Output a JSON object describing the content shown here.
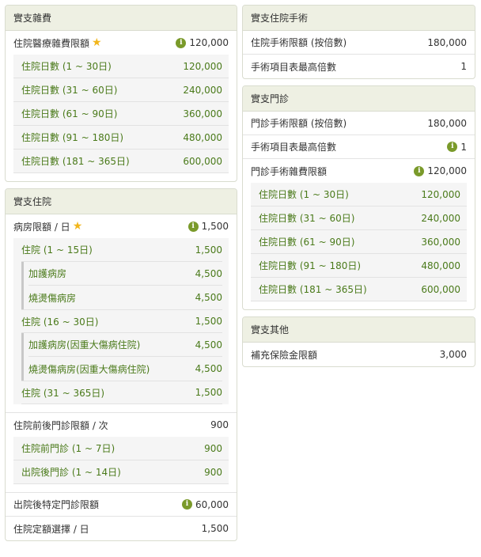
{
  "misc": {
    "header": "實支雜費",
    "limit_label": "住院醫療雜費限額",
    "limit_value": "120,000",
    "items": [
      {
        "label": "住院日數 (1 ~ 30日)",
        "value": "120,000"
      },
      {
        "label": "住院日數 (31 ~ 60日)",
        "value": "240,000"
      },
      {
        "label": "住院日數 (61 ~ 90日)",
        "value": "360,000"
      },
      {
        "label": "住院日數 (91 ~ 180日)",
        "value": "480,000"
      },
      {
        "label": "住院日數 (181 ~ 365日)",
        "value": "600,000"
      }
    ]
  },
  "hosp": {
    "header": "實支住院",
    "room_label": "病房限額 / 日",
    "room_value": "1,500",
    "tiers": [
      {
        "label": "住院 (1 ~ 15日)",
        "value": "1,500",
        "subs": [
          {
            "label": "加護病房",
            "value": "4,500"
          },
          {
            "label": "燒燙傷病房",
            "value": "4,500"
          }
        ]
      },
      {
        "label": "住院 (16 ~ 30日)",
        "value": "1,500",
        "subs": [
          {
            "label": "加護病房(因重大傷病住院)",
            "value": "4,500"
          },
          {
            "label": "燒燙傷病房(因重大傷病住院)",
            "value": "4,500"
          }
        ]
      },
      {
        "label": "住院 (31 ~ 365日)",
        "value": "1,500"
      }
    ],
    "outpatient_label": "住院前後門診限額 / 次",
    "outpatient_value": "900",
    "outpatient_items": [
      {
        "label": "住院前門診 (1 ~ 7日)",
        "value": "900"
      },
      {
        "label": "出院後門診 (1 ~ 14日)",
        "value": "900"
      }
    ],
    "special_label": "出院後特定門診限額",
    "special_value": "60,000",
    "fixed_label": "住院定額選擇 / 日",
    "fixed_value": "1,500"
  },
  "surgery": {
    "header": "實支住院手術",
    "rows": [
      {
        "label": "住院手術限額 (按倍數)",
        "value": "180,000"
      },
      {
        "label": "手術項目表最高倍數",
        "value": "1"
      }
    ]
  },
  "clinic": {
    "header": "實支門診",
    "row1_label": "門診手術限額 (按倍數)",
    "row1_value": "180,000",
    "row2_label": "手術項目表最高倍數",
    "row2_value": "1",
    "misc_label": "門診手術雜費限額",
    "misc_value": "120,000",
    "items": [
      {
        "label": "住院日數 (1 ~ 30日)",
        "value": "120,000"
      },
      {
        "label": "住院日數 (31 ~ 60日)",
        "value": "240,000"
      },
      {
        "label": "住院日數 (61 ~ 90日)",
        "value": "360,000"
      },
      {
        "label": "住院日數 (91 ~ 180日)",
        "value": "480,000"
      },
      {
        "label": "住院日數 (181 ~ 365日)",
        "value": "600,000"
      }
    ]
  },
  "other": {
    "header": "實支其他",
    "rows": [
      {
        "label": "補充保險金限額",
        "value": "3,000"
      }
    ]
  },
  "icons": {
    "info": "i",
    "star": "★"
  },
  "colors": {
    "header_bg": "#eef0e3",
    "accent_green": "#4a7a1a",
    "info_icon": "#7a9a2a",
    "star": "#f2b61c"
  }
}
